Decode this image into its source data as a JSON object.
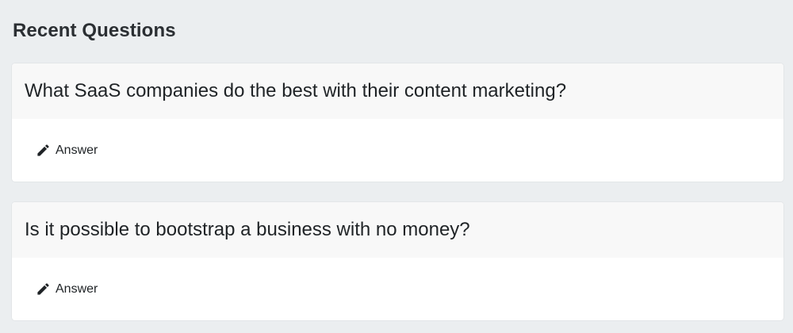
{
  "section": {
    "title": "Recent Questions"
  },
  "questions": [
    {
      "text": "What SaaS companies do the best with their content marketing?",
      "action_label": "Answer",
      "action_icon": "pencil-icon"
    },
    {
      "text": "Is it possible to bootstrap a business with no money?",
      "action_label": "Answer",
      "action_icon": "pencil-icon"
    }
  ],
  "colors": {
    "page_background": "#ebeef0",
    "card_background": "#ffffff",
    "card_header_background": "#f8f8f8",
    "text": "#1f2326"
  }
}
